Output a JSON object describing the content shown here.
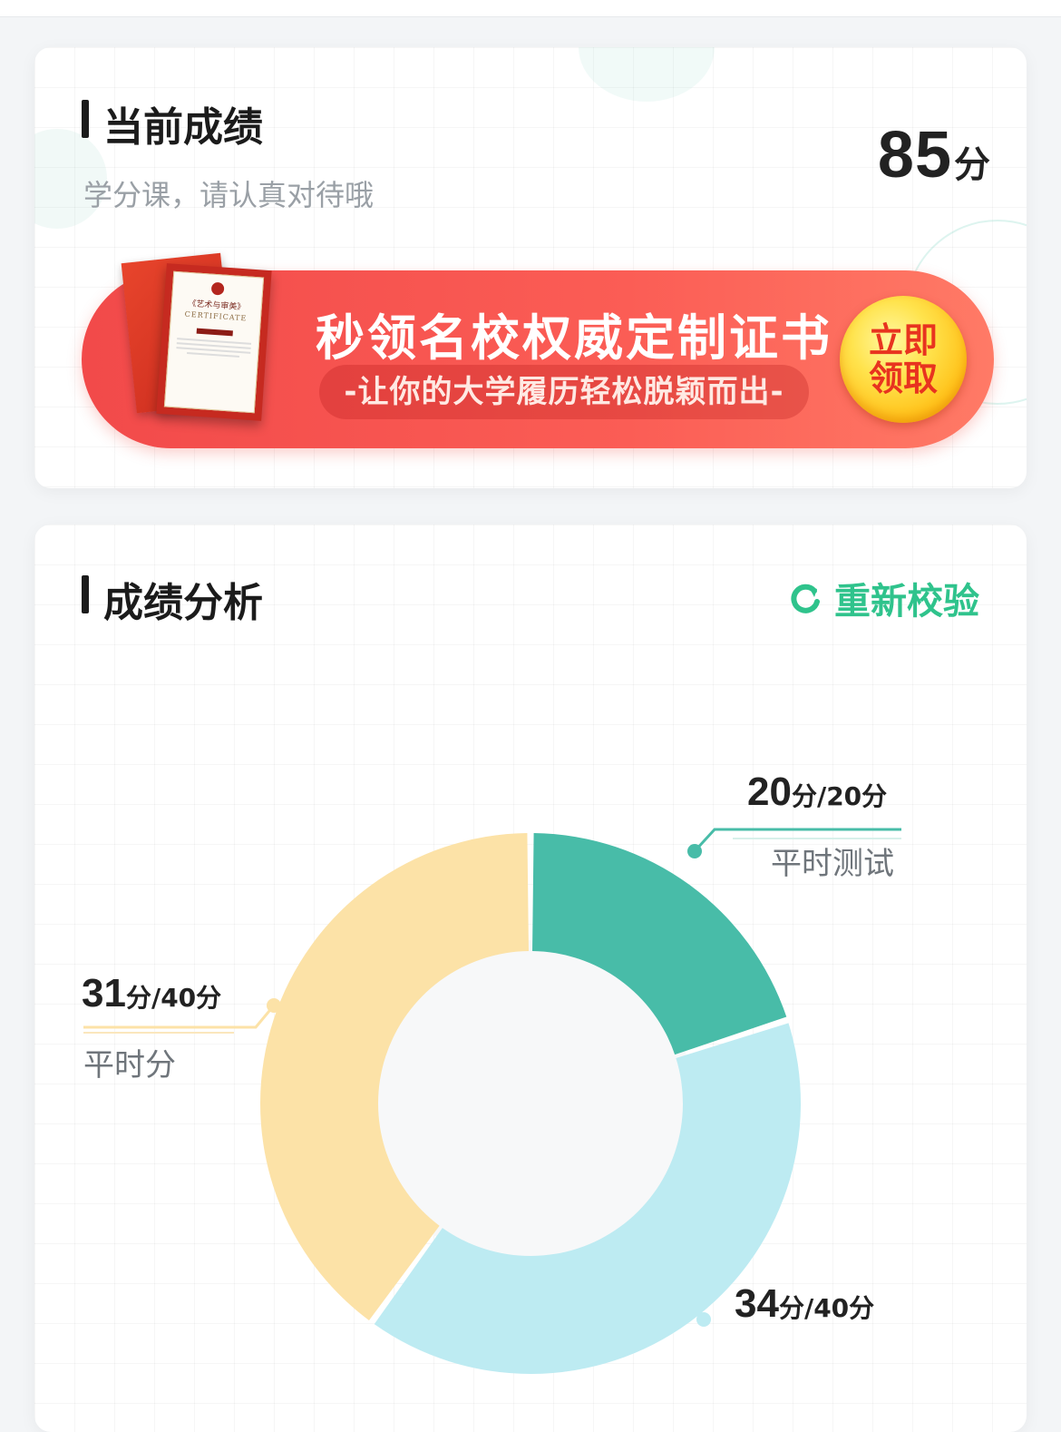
{
  "score_card": {
    "title": "当前成绩",
    "subtitle": "学分课，请认真对待哦",
    "score_value": "85",
    "score_unit": "分",
    "banner": {
      "headline": "秒领名校权威定制证书",
      "tagline": "-让你的大学履历轻松脱颖而出-",
      "button_line1": "立即",
      "button_line2": "领取",
      "certificate_title": "《艺术与审美》",
      "certificate_word": "CERTIFICATE"
    }
  },
  "analysis_card": {
    "title": "成绩分析",
    "recheck_label": "重新校验"
  },
  "chart_data": {
    "type": "pie",
    "donut": true,
    "slices": [
      {
        "name": "平时测试",
        "value": 20,
        "max": 20,
        "color": "#48bca8",
        "score_text": "20",
        "max_text": "/20分"
      },
      {
        "name": "",
        "value": 34,
        "max": 40,
        "color": "#bdebf2",
        "score_text": "34",
        "max_text": "/40分"
      },
      {
        "name": "平时分",
        "value": 31,
        "max": 40,
        "color": "#fce2a7",
        "score_text": "31",
        "max_text": "/40分"
      }
    ],
    "unit": "分"
  }
}
